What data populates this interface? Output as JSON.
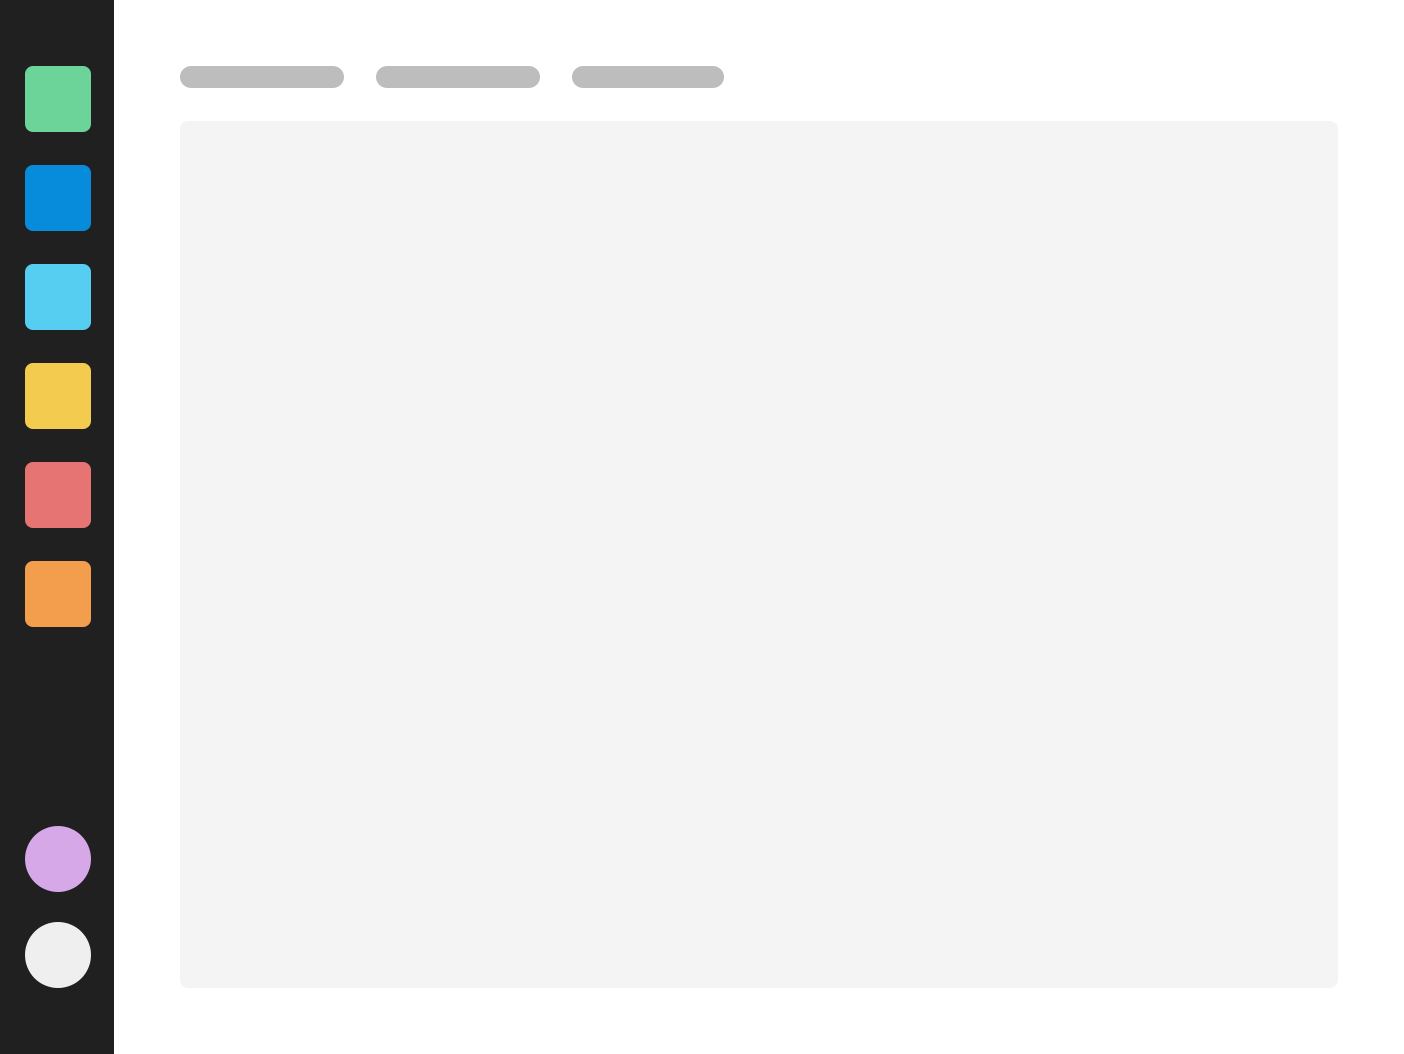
{
  "sidebar": {
    "background": "#202020",
    "apps": [
      {
        "name": "app-green",
        "color": "#6cd399"
      },
      {
        "name": "app-blue",
        "color": "#078cdc"
      },
      {
        "name": "app-light-blue",
        "color": "#55cef2"
      },
      {
        "name": "app-yellow",
        "color": "#f3cc4f"
      },
      {
        "name": "app-red",
        "color": "#e67472"
      },
      {
        "name": "app-orange",
        "color": "#f39e4d"
      }
    ],
    "bottom": [
      {
        "name": "user-avatar",
        "color": "#d6a8e8"
      },
      {
        "name": "settings-circle",
        "color": "#efefef"
      }
    ]
  },
  "tabs": [
    {
      "name": "tab-1",
      "label": "",
      "color": "#bdbdbd"
    },
    {
      "name": "tab-2",
      "label": "",
      "color": "#bdbdbd"
    },
    {
      "name": "tab-3",
      "label": "",
      "color": "#bdbdbd"
    }
  ],
  "content": {
    "background": "#f4f4f4"
  }
}
